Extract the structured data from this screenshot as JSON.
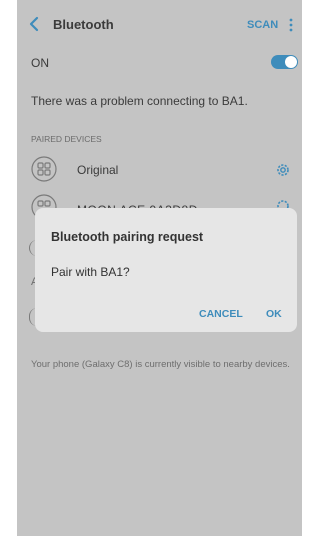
{
  "header": {
    "title": "Bluetooth",
    "scan_label": "SCAN"
  },
  "toggle_row": {
    "label": "ON",
    "state": "on",
    "accent_color": "#3e8cbb"
  },
  "status_message": "There was a problem connecting to BA1.",
  "paired_section": {
    "title": "PAIRED DEVICES",
    "devices": [
      {
        "name": "Original"
      },
      {
        "name": "MOON ACE 9A3D8D"
      }
    ]
  },
  "available_section": {
    "title_visible": "A"
  },
  "visibility_note": "Your phone (Galaxy C8) is currently visible to nearby devices.",
  "dialog": {
    "title": "Bluetooth pairing request",
    "message": "Pair with BA1?",
    "cancel_label": "CANCEL",
    "ok_label": "OK"
  },
  "icons": {
    "back": "chevron-left-icon",
    "more": "more-vert-icon",
    "device": "device-icon",
    "settings": "gear-icon"
  }
}
